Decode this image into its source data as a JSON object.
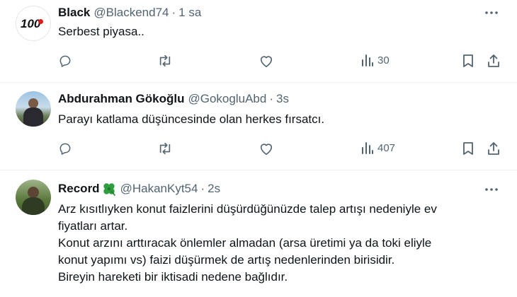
{
  "tweets": [
    {
      "name": "Black",
      "handle": "@Blackend74",
      "separator": "·",
      "time": "1 sa",
      "text": "Serbest piyasa..",
      "views": "30",
      "avatar_text": "100"
    },
    {
      "name": "Abdurahman Gökoğlu",
      "handle": "@GokogluAbd",
      "separator": "·",
      "time": "3s",
      "text": "Parayı katlama düşüncesinde olan herkes fırsatcı.",
      "views": "407"
    },
    {
      "name": "Record",
      "handle": "@HakanKyt54",
      "separator": "·",
      "time": "2s",
      "text_lines": [
        "Arz kısıtlıyken konut faizlerini düşürdüğünüzde talep artışı nedeniyle ev",
        "fiyatları artar.",
        "Konut arzını arttıracak önlemler almadan (arsa üretimi ya da toki eliyle",
        "konut yapımı vs) faizi düşürmek de artış nedenlerinden birisidir.",
        "Bireyin hareketi bir iktisadi nedene bağlıdır."
      ],
      "name_emoji": "four-leaf-clover-icon"
    }
  ],
  "colors": {
    "text": "#0f1419",
    "secondary": "#536471",
    "divider": "#eff3f4",
    "clover": "#2e9e3f"
  }
}
